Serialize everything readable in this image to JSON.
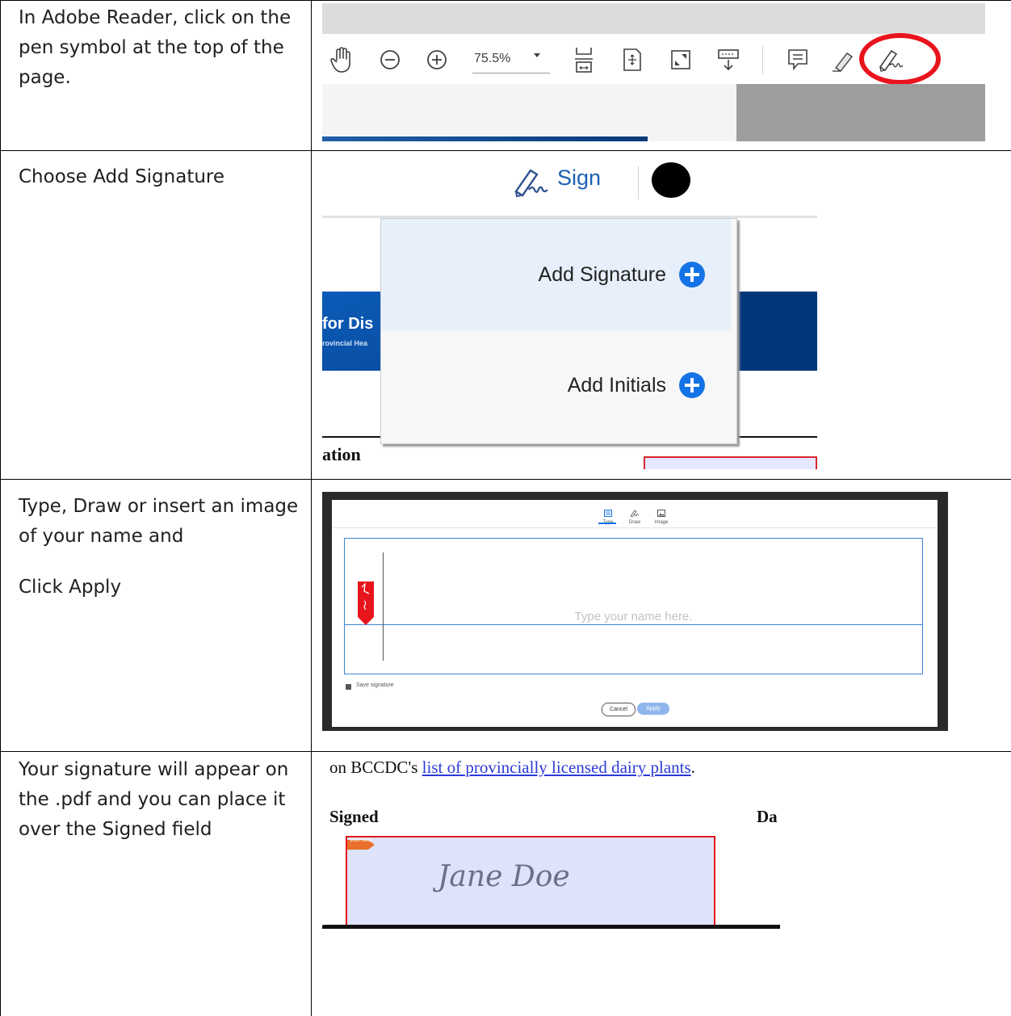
{
  "rows": [
    {
      "instruction": "In Adobe Reader, click on the pen symbol at the top of the page."
    },
    {
      "instruction": "Choose Add Signature"
    },
    {
      "instruction_lines": [
        "Type, Draw or insert an image of your name and",
        "Click Apply"
      ]
    },
    {
      "instruction": "Your signature will appear on the .pdf and you can place it over the Signed field"
    }
  ],
  "toolbar": {
    "zoom_value": "75.5%",
    "icons": [
      "hand-icon",
      "zoom-out-icon",
      "zoom-in-icon",
      "fit-width-icon",
      "fit-page-icon",
      "fullscreen-icon",
      "scroll-mode-icon",
      "comment-icon",
      "highlight-icon",
      "sign-pen-icon"
    ],
    "highlight_color": "#e8141c"
  },
  "sign_menu": {
    "sign_label": "Sign",
    "fragment_text_1": "for Dis",
    "fragment_text_2": "rovincial Hea",
    "fragment_text_3": "ation",
    "items": [
      {
        "label": "Add Signature"
      },
      {
        "label": "Add Initials"
      }
    ],
    "accent_color": "#1473e6"
  },
  "signature_dialog": {
    "tabs": [
      {
        "label": "Type",
        "icon": "type-icon",
        "active": true
      },
      {
        "label": "Draw",
        "icon": "draw-icon",
        "active": false
      },
      {
        "label": "Image",
        "icon": "image-icon",
        "active": false
      }
    ],
    "placeholder": "Type your name here.",
    "save_signature_label": "Save signature",
    "save_signature_checked": true,
    "cancel_label": "Cancel",
    "apply_label": "Apply"
  },
  "signed_field": {
    "text_prefix": "on BCCDC's ",
    "link_text": "list of provincially licensed dairy plants",
    "text_suffix": ".",
    "signed_label": "Signed",
    "date_label_fragment": "Da",
    "flag_text": "SIGN HERE",
    "signature": "Jane Doe"
  }
}
